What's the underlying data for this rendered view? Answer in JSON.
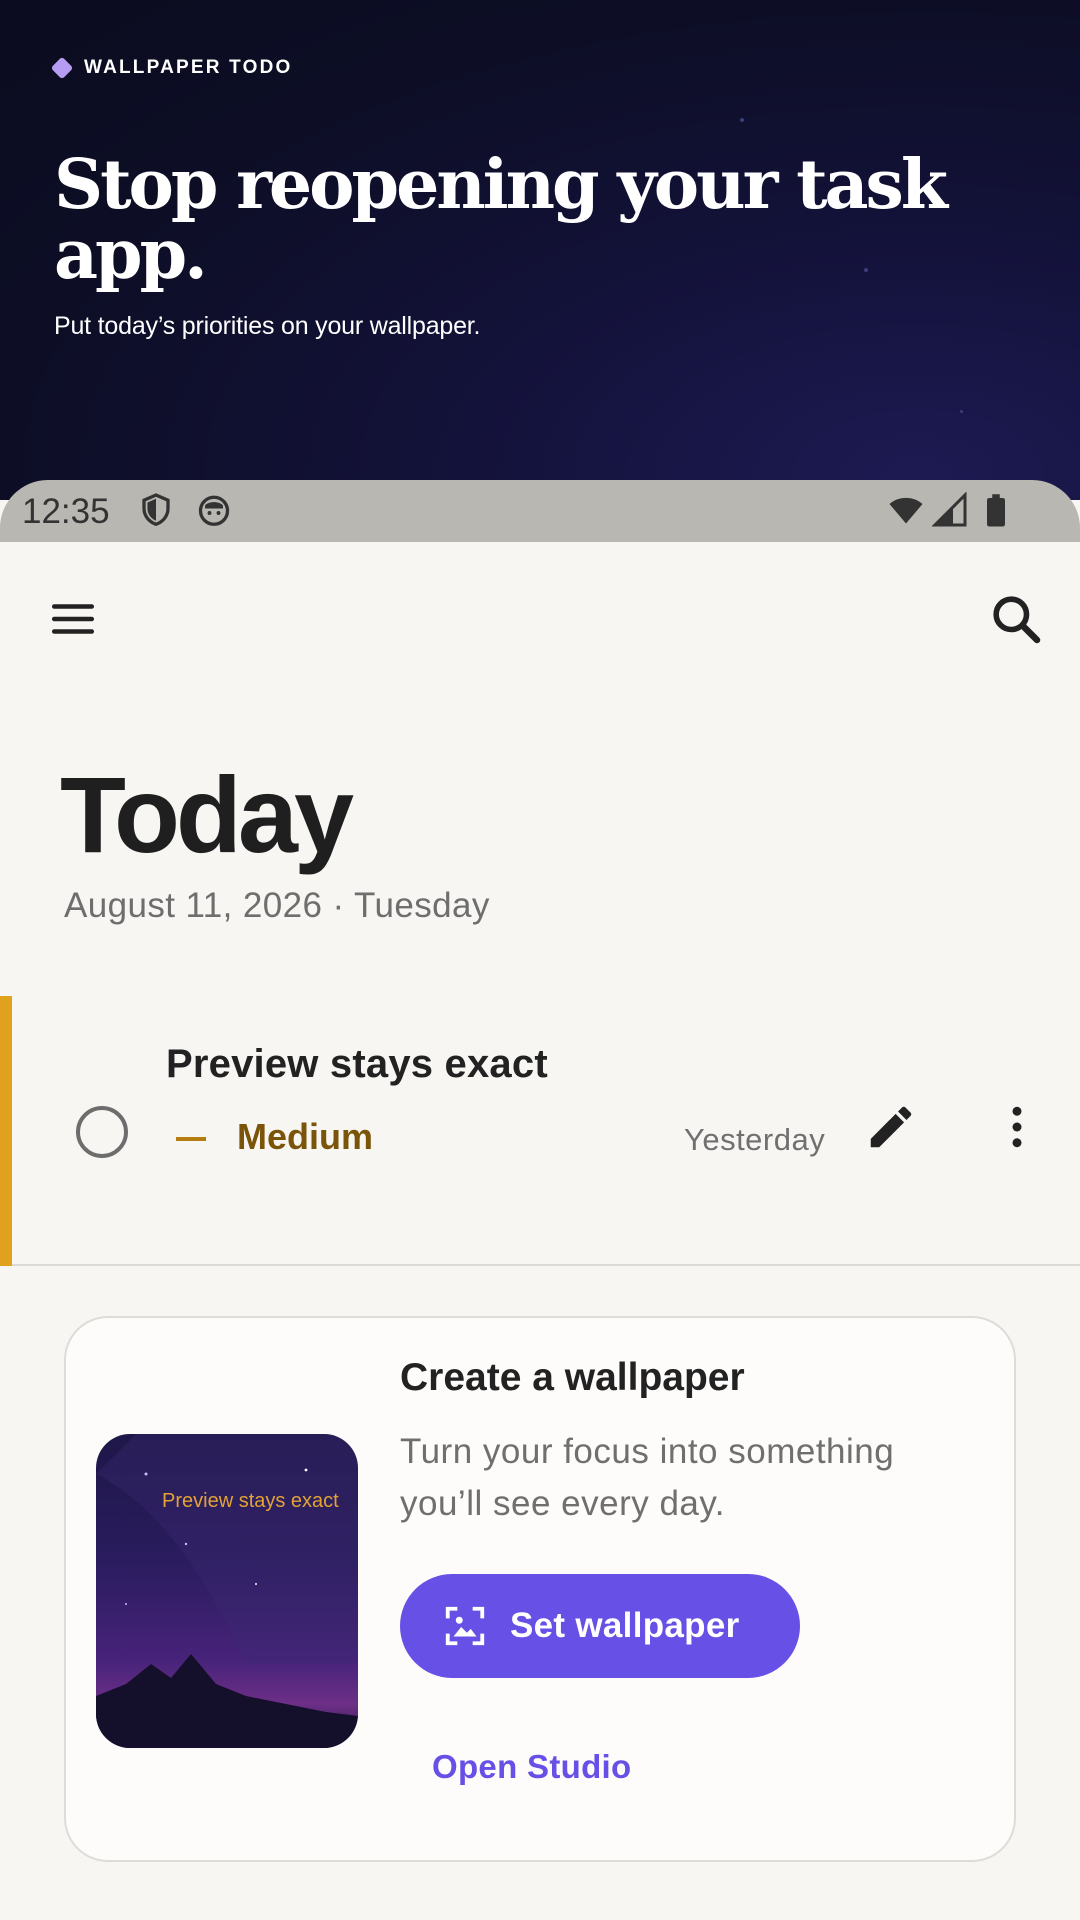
{
  "hero": {
    "kicker": "WALLPAPER TODO",
    "title": "Stop reopening your task app.",
    "subtitle": "Put today’s priorities on your wallpaper."
  },
  "status_bar": {
    "time": "12:35",
    "left_icons": [
      "shield-icon",
      "cat-face-icon"
    ],
    "right_icons": [
      "wifi-icon",
      "signal-icon",
      "battery-icon"
    ]
  },
  "toolbar": {
    "menu_icon": "menu-icon",
    "search_icon": "search-icon"
  },
  "page": {
    "title": "Today",
    "date": "August 11, 2026 · Tuesday"
  },
  "task": {
    "title": "Preview stays exact",
    "priority": "Medium",
    "due": "Yesterday",
    "completed": false,
    "accent_color": "#e0a21c"
  },
  "wallpaper_card": {
    "title": "Create a wallpaper",
    "body": "Turn your focus into something you’ll see every day.",
    "preview_text": "Preview stays exact",
    "primary_button": "Set wallpaper",
    "secondary_button": "Open Studio"
  },
  "colors": {
    "primary": "#6750e5",
    "priority_medium": "#e0a21c",
    "hero_background": "#0d0e26"
  }
}
